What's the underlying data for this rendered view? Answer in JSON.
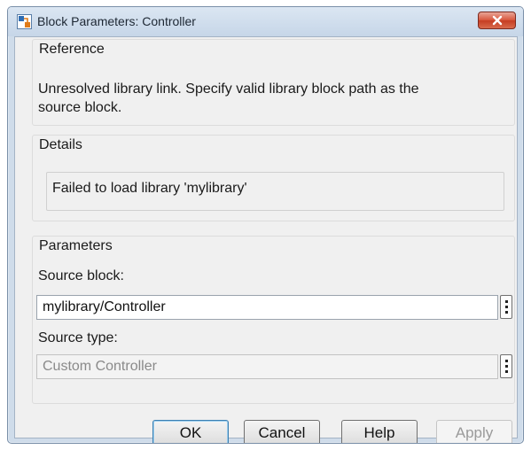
{
  "window": {
    "title": "Block Parameters: Controller"
  },
  "reference": {
    "title": "Reference",
    "message_line1": "Unresolved library link. Specify valid library block path as the",
    "message_line2": "source block."
  },
  "details": {
    "title": "Details",
    "message": "Failed to load library 'mylibrary'"
  },
  "parameters": {
    "title": "Parameters",
    "source_block_label": "Source block:",
    "source_block_value": "mylibrary/Controller",
    "source_type_label": "Source type:",
    "source_type_value": "Custom Controller"
  },
  "buttons": {
    "ok": "OK",
    "cancel": "Cancel",
    "help": "Help",
    "apply": "Apply"
  },
  "icons": {
    "window_icon": "block-parameters-icon",
    "close": "close-icon",
    "more": "ellipsis-vertical-icon"
  },
  "colors": {
    "close_button": "#d9583f",
    "title_bar": "#cfdcea",
    "dialog_background": "#f0f0f0"
  }
}
